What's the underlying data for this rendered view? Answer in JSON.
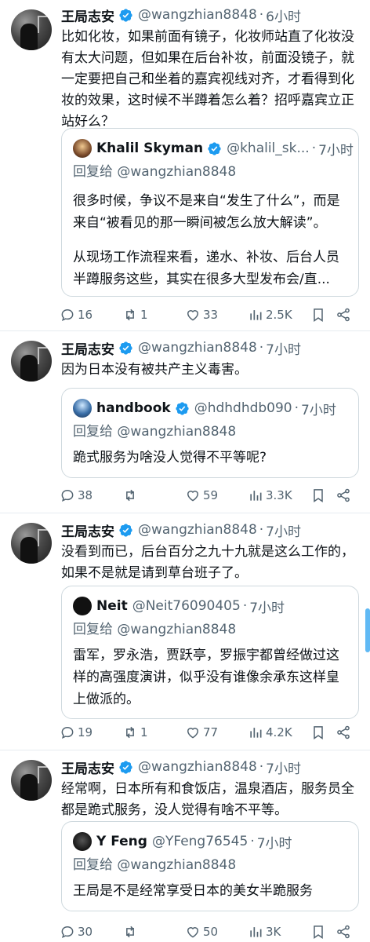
{
  "colors": {
    "accent": "#1d9bf0",
    "text": "#0f1419",
    "muted": "#536471",
    "border": "#cfd9de",
    "divider": "#e6ecf0"
  },
  "icons": {
    "verified": "verified-badge-icon",
    "reply": "reply-icon",
    "retweet": "retweet-icon",
    "like": "like-icon",
    "views": "views-icon",
    "bookmark": "bookmark-icon",
    "share": "share-icon"
  },
  "tweets": [
    {
      "author": "王局志安",
      "handle": "@wangzhian8848",
      "dot": "·",
      "time": "6小时",
      "text": "比如化妆，如果前面有镜子，化妆师站直了化妆没有太大问题，但如果在后台补妆，前面没镜子，就一定要把自己和坐着的嘉宾视线对齐，才看得到化妆的效果，这时候不半蹲着怎么着？招呼嘉宾立正站好么？",
      "quote": {
        "author": "Khalil Skyman",
        "handle": "@khalil_sk...",
        "dot": "·",
        "time": "7小时",
        "reply_to": "回复给 @wangzhian8848",
        "text_1": "很多时候，争议不是来自“发生了什么”，而是来自“被看见的那一瞬间被怎么放大解读”。",
        "text_2": "从现场工作流程来看，递水、补妆、后台人员半蹲服务这些，其实在很多大型发布会/直..."
      },
      "stats": {
        "replies": "16",
        "retweets": "1",
        "likes": "33",
        "views": "2.5K"
      }
    },
    {
      "author": "王局志安",
      "handle": "@wangzhian8848",
      "dot": "·",
      "time": "7小时",
      "text": "因为日本没有被共产主义毒害。",
      "quote": {
        "author": "handbook",
        "handle": "@hdhdhdb090",
        "dot": "·",
        "time": "7小时",
        "reply_to": "回复给 @wangzhian8848",
        "text_1": "跪式服务为啥没人觉得不平等呢?"
      },
      "stats": {
        "replies": "38",
        "retweets": "",
        "likes": "59",
        "views": "3.3K"
      }
    },
    {
      "author": "王局志安",
      "handle": "@wangzhian8848",
      "dot": "·",
      "time": "7小时",
      "text": "没看到而已，后台百分之九十九就是这么工作的，如果不是就是请到草台班子了。",
      "quote": {
        "author": "Neit",
        "handle": "@Neit76090405",
        "dot": "·",
        "time": "7小时",
        "reply_to": "回复给 @wangzhian8848",
        "text_1": "雷军，罗永浩，贾跃亭，罗振宇都曾经做过这样的高强度演讲，似乎没有谁像余承东这样皇上做派的。"
      },
      "stats": {
        "replies": "19",
        "retweets": "1",
        "likes": "77",
        "views": "4.2K"
      }
    },
    {
      "author": "王局志安",
      "handle": "@wangzhian8848",
      "dot": "·",
      "time": "7小时",
      "text": "经常啊，日本所有和食饭店，温泉酒店，服务员全都是跪式服务，没人觉得有啥不平等。",
      "quote": {
        "author": "Y Feng",
        "handle": "@YFeng76545",
        "dot": "·",
        "time": "7小时",
        "reply_to": "回复给 @wangzhian8848",
        "text_1": "王局是不是经常享受日本的美女半跪服务"
      },
      "stats": {
        "replies": "30",
        "retweets": "",
        "likes": "50",
        "views": "3K"
      }
    }
  ]
}
